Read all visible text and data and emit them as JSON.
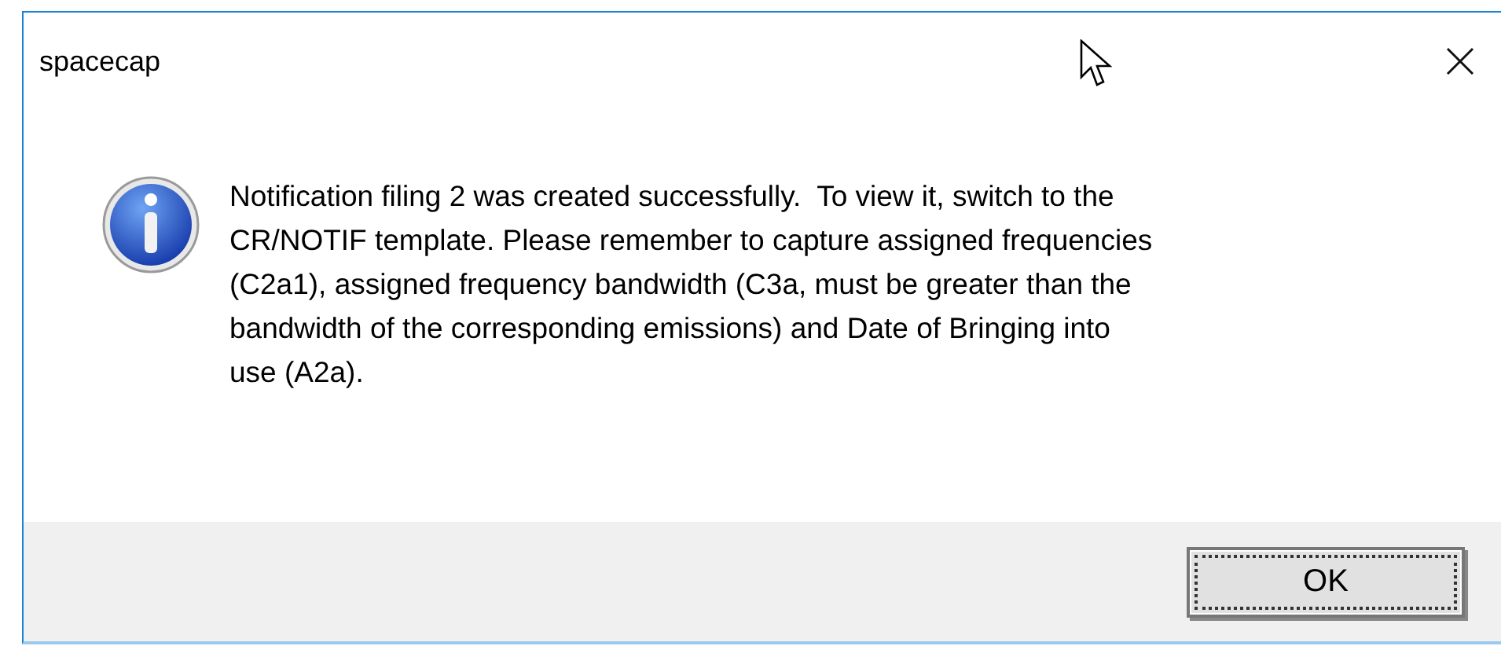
{
  "window": {
    "title": "spacecap"
  },
  "message": {
    "lines": [
      "Notification filing 2 was created successfully.  To view it, switch to the",
      "CR/NOTIF template. Please remember to capture assigned frequencies",
      "(C2a1), assigned frequency bandwidth (C3a, must be greater than the",
      "bandwidth of the corresponding emissions) and Date of Bringing into",
      "use (A2a)."
    ]
  },
  "buttons": [
    {
      "label": "OK",
      "focused": true
    }
  ]
}
